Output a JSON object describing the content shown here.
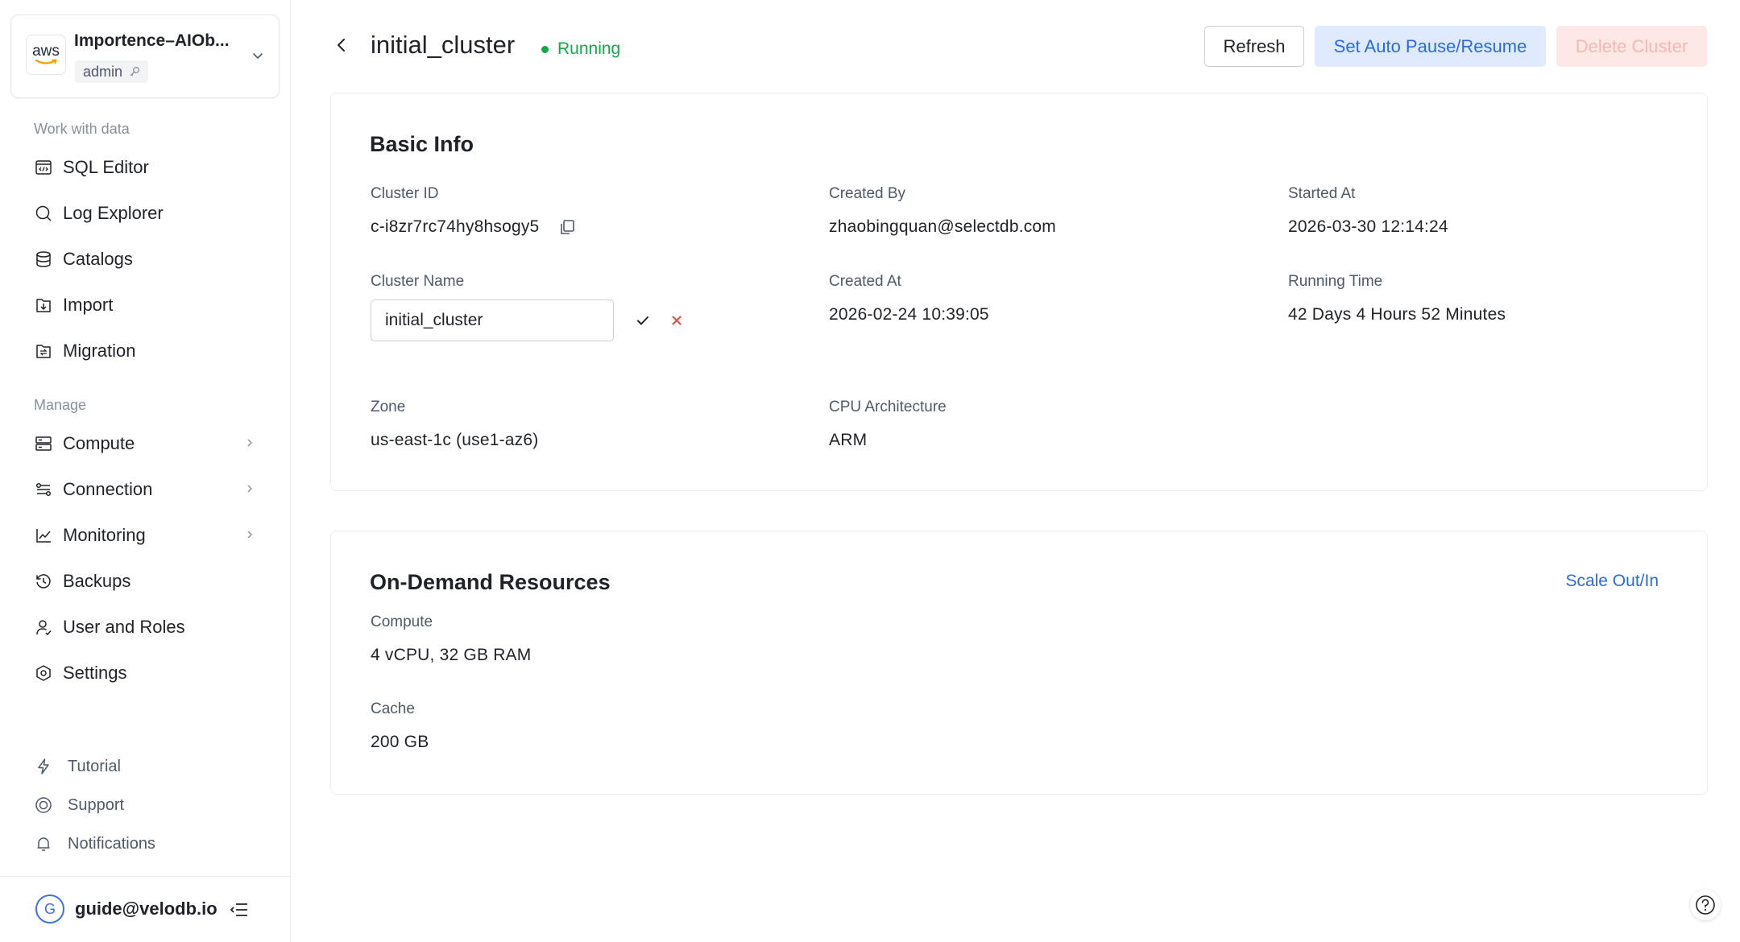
{
  "org": {
    "name": "Importence–AIOb...",
    "role": "admin",
    "cloud_logo": "aws"
  },
  "sidebar": {
    "sections": [
      {
        "label": "Work with data"
      },
      {
        "label": "Manage"
      }
    ],
    "items": [
      {
        "label": "SQL Editor",
        "icon": "code-window-icon"
      },
      {
        "label": "Log Explorer",
        "icon": "search-icon"
      },
      {
        "label": "Catalogs",
        "icon": "database-icon"
      },
      {
        "label": "Import",
        "icon": "import-icon"
      },
      {
        "label": "Migration",
        "icon": "migration-icon"
      },
      {
        "label": "Compute",
        "icon": "server-icon",
        "expandable": true
      },
      {
        "label": "Connection",
        "icon": "connection-icon",
        "expandable": true
      },
      {
        "label": "Monitoring",
        "icon": "chart-line-icon",
        "expandable": true
      },
      {
        "label": "Backups",
        "icon": "history-icon"
      },
      {
        "label": "User and Roles",
        "icon": "user-icon"
      },
      {
        "label": "Settings",
        "icon": "settings-icon"
      }
    ],
    "footer_items": [
      {
        "label": "Tutorial",
        "icon": "lightning-icon"
      },
      {
        "label": "Support",
        "icon": "lifebuoy-icon"
      },
      {
        "label": "Notifications",
        "icon": "bell-icon"
      }
    ],
    "user": {
      "initial": "G",
      "email": "guide@velodb.io"
    }
  },
  "header": {
    "title": "initial_cluster",
    "status": "Running",
    "buttons": {
      "refresh": "Refresh",
      "auto_pause": "Set Auto Pause/Resume",
      "delete": "Delete Cluster"
    }
  },
  "basic_info": {
    "title": "Basic Info",
    "cluster_id": {
      "label": "Cluster ID",
      "value": "c-i8zr7rc74hy8hsogy5"
    },
    "created_by": {
      "label": "Created By",
      "value": "zhaobingquan@selectdb.com"
    },
    "started_at": {
      "label": "Started At",
      "value": "2026-03-30 12:14:24"
    },
    "cluster_name": {
      "label": "Cluster Name",
      "value": "initial_cluster"
    },
    "created_at": {
      "label": "Created At",
      "value": "2026-02-24 10:39:05"
    },
    "running_time": {
      "label": "Running Time",
      "value": "42 Days 4 Hours 52 Minutes"
    },
    "zone": {
      "label": "Zone",
      "value": "us-east-1c (use1-az6)"
    },
    "cpu_arch": {
      "label": "CPU Architecture",
      "value": "ARM"
    }
  },
  "resources": {
    "title": "On-Demand Resources",
    "scale_link": "Scale Out/In",
    "compute": {
      "label": "Compute",
      "value": "4 vCPU, 32 GB RAM"
    },
    "cache": {
      "label": "Cache",
      "value": "200 GB"
    }
  },
  "colors": {
    "accent": "#2b6be0",
    "running": "#14a948",
    "danger_light": "#fde8e6"
  }
}
